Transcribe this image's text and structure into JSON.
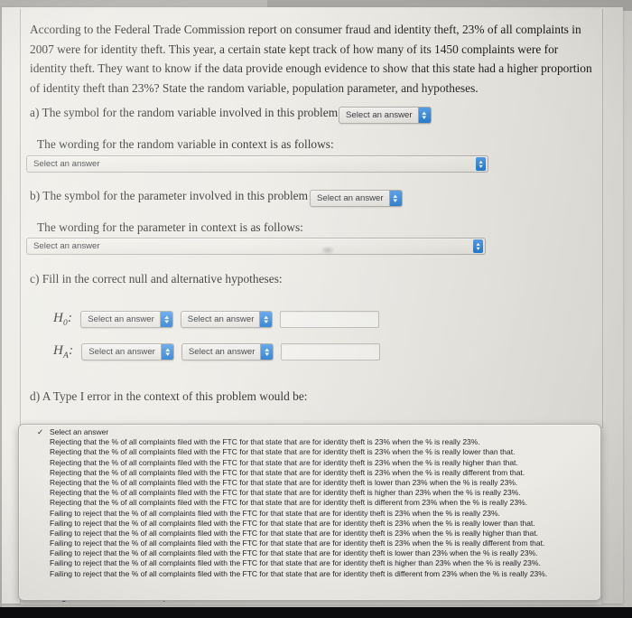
{
  "prompt": {
    "paragraph": "According to the Federal Trade Commission report on consumer fraud and identity theft, 23% of all complaints in 2007 were for identity theft. This year, a certain state kept track of how many of its 1450 complaints were for identity theft. They want to know if the data provide enough evidence to show that this state had a higher proportion of identity theft than 23%? State the random variable, population parameter, and hypotheses."
  },
  "parts": {
    "a": {
      "label": "a) The symbol for the random variable involved in this problem is",
      "select_value": "Select an answer",
      "wording_label": "The wording for the random variable in context is as follows:",
      "wording_select_value": "Select an answer"
    },
    "b": {
      "label": "b) The symbol for the parameter involved in this problem is",
      "select_value": "Select an answer",
      "wording_label": "The wording for the parameter in context is as follows:",
      "wording_select_value": "Select an answer"
    },
    "c": {
      "label": "c) Fill in the correct null and alternative hypotheses:",
      "null_symbol": "H",
      "null_subscript": "0",
      "alt_symbol": "H",
      "alt_subscript": "A",
      "colon": ":",
      "h0_select1": "Select an answer",
      "h0_select2": "Select an answer",
      "h0_input_value": "",
      "ha_select1": "Select an answer",
      "ha_select2": "Select an answer",
      "ha_input_value": ""
    },
    "d": {
      "label": "d) A Type I error in the context of this problem would be:"
    }
  },
  "dropdown": {
    "checkmark": "✓",
    "selected_option": "Select an answer",
    "options": [
      "Select an answer",
      "Rejecting that the % of all complaints filed with the FTC for that state that are for identity theft is 23% when the % is really 23%.",
      "Rejecting that the % of all complaints filed with the FTC for that state that are for identity theft is 23% when the % is really lower than that.",
      "Rejecting that the % of all complaints filed with the FTC for that state that are for identity theft is 23% when the % is really higher than that.",
      "Rejecting that the % of all complaints filed with the FTC for that state that are for identity theft is 23% when the % is really different from that.",
      "Rejecting that the % of all complaints filed with the FTC for that state that are for identity theft is lower than 23% when the % is really 23%.",
      "Rejecting that the % of all complaints filed with the FTC for that state that are for identity theft is higher than 23% when the % is really 23%.",
      "Rejecting that the % of all complaints filed with the FTC for that state that are for identity theft is different from 23% when the % is really 23%.",
      "Failing to reject that the % of all complaints filed with the FTC for that state that are for identity theft is 23% when the % is really 23%.",
      "Failing to reject that the % of all complaints filed with the FTC for that state that are for identity theft is 23% when the % is really lower than that.",
      "Failing to reject that the % of all complaints filed with the FTC for that state that are for identity theft is 23% when the % is really higher than that.",
      "Failing to reject that the % of all complaints filed with the FTC for that state that are for identity theft is 23% when the % is really different from that.",
      "Failing to reject that the % of all complaints filed with the FTC for that state that are for identity theft is lower than 23% when the % is really 23%.",
      "Failing to reject that the % of all complaints filed with the FTC for that state that are for identity theft is higher than 23% when the % is really 23%.",
      "Failing to reject that the % of all complaints filed with the FTC for that state that are for identity theft is different from 23% when the % is really 23%."
    ]
  },
  "footer": {
    "message_instructor_link": "Message instructor about this question"
  },
  "icons": {
    "arrow_up": "▴",
    "arrow_down": "▾"
  },
  "colors": {
    "select_arrow_blue": "#1672cc",
    "page_background": "#e9e7e1",
    "link_color": "#2f3a6e"
  }
}
